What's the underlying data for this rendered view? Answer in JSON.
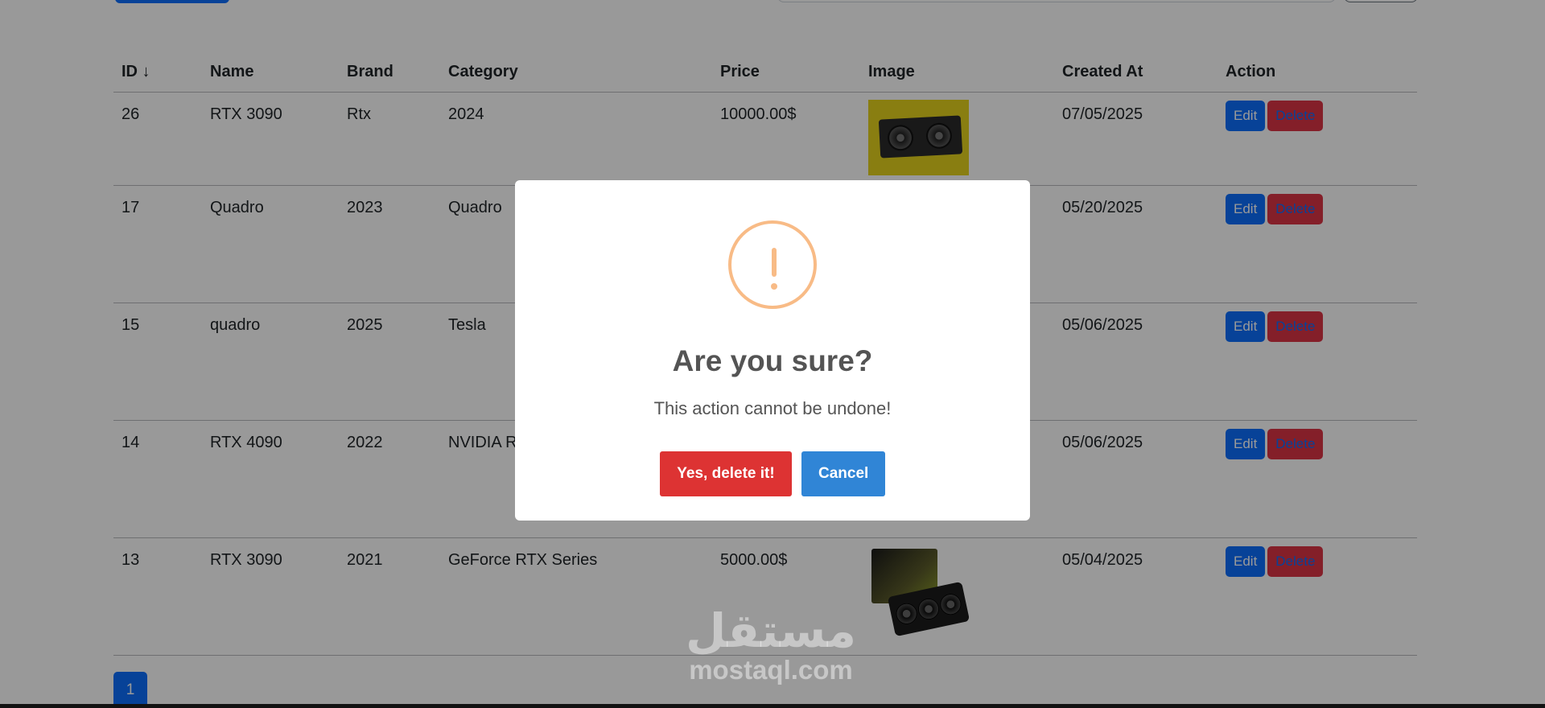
{
  "table": {
    "headers": [
      "ID ↓",
      "Name",
      "Brand",
      "Category",
      "Price",
      "Image",
      "Created At",
      "Action"
    ],
    "rows": [
      {
        "id": "26",
        "name": "RTX 3090",
        "brand": "Rtx",
        "category": "2024",
        "price": "10000.00$",
        "created": "07/05/2025"
      },
      {
        "id": "17",
        "name": "Quadro",
        "brand": "2023",
        "category": "Quadro",
        "price": "",
        "created": "05/20/2025"
      },
      {
        "id": "15",
        "name": "quadro",
        "brand": "2025",
        "category": "Tesla",
        "price": "",
        "created": "05/06/2025"
      },
      {
        "id": "14",
        "name": "RTX 4090",
        "brand": "2022",
        "category": "NVIDIA R",
        "price": "",
        "created": "05/06/2025"
      },
      {
        "id": "13",
        "name": "RTX 3090",
        "brand": "2021",
        "category": "GeForce RTX Series",
        "price": "5000.00$",
        "created": "05/04/2025"
      }
    ],
    "edit_label": "Edit",
    "delete_label": "Delete"
  },
  "pagination": {
    "current": "1"
  },
  "modal": {
    "title": "Are you sure?",
    "text": "This action cannot be undone!",
    "confirm_label": "Yes, delete it!",
    "cancel_label": "Cancel",
    "icon": "warning-icon"
  },
  "watermark": {
    "arabic": "مستقل",
    "latin": "mostaql.com"
  },
  "colors": {
    "primary": "#0d6efd",
    "danger": "#dc3545",
    "overlay": "rgba(0,0,0,0.4)",
    "warning_icon": "#f8bb86",
    "confirm": "#dd3333",
    "cancel": "#3085d6"
  }
}
